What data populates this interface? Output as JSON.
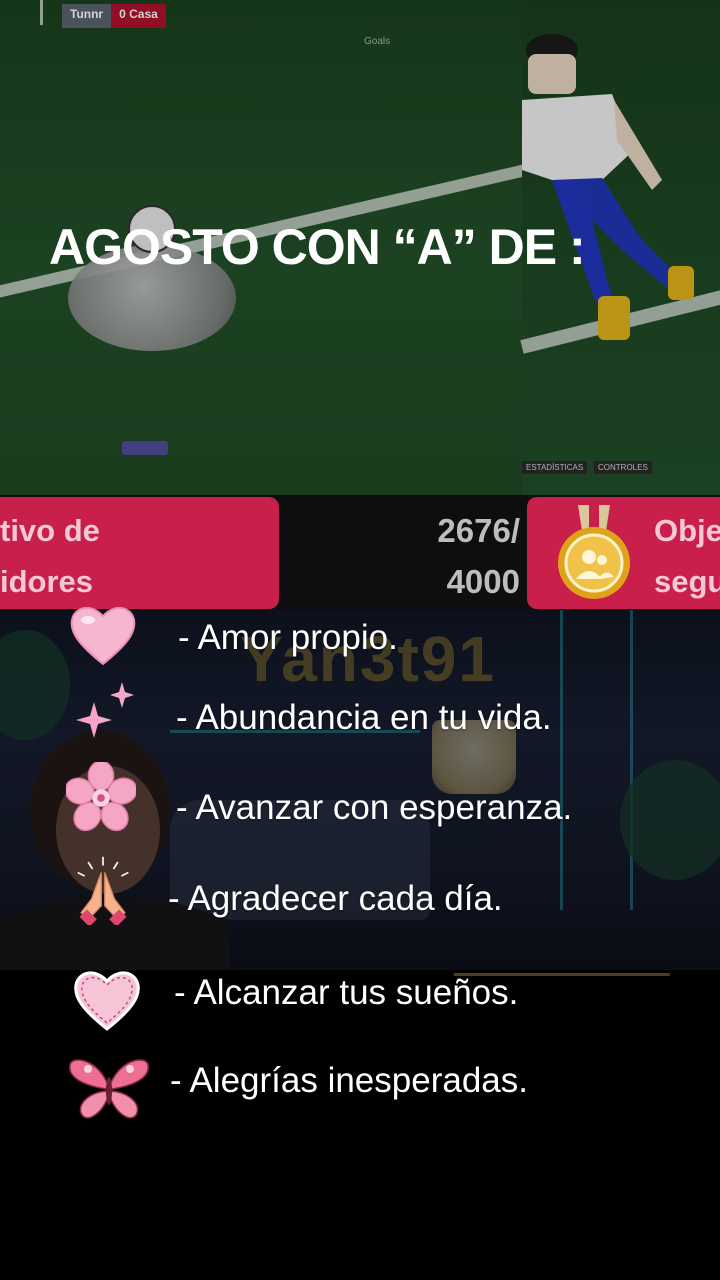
{
  "title": "AGOSTO CON “A” DE :",
  "game": {
    "score_home": "Tunnr",
    "score_value": "0",
    "score_away": "Casa",
    "mini_label": "Goals",
    "btn_stats": "ESTADÍSTICAS",
    "btn_controls": "CONTROLES"
  },
  "goal": {
    "left_text_line1": "tivo de",
    "left_text_line2": "idores",
    "counter_line1": "2676/",
    "counter_line2": "4000",
    "right_text_line1": "Obje",
    "right_text_line2": "segu",
    "colors": {
      "card": "#c8204b",
      "medal": "#e0a21b"
    }
  },
  "stream": {
    "channel_name": "Yan3t91"
  },
  "list": [
    {
      "icon": "pink-heart-icon",
      "text": "- Amor propio."
    },
    {
      "icon": "sparkles-icon",
      "text": "- Abundancia en tu vida."
    },
    {
      "icon": "cherry-blossom-icon",
      "text": "- Avanzar con esperanza."
    },
    {
      "icon": "praying-hands-icon",
      "text": "- Agradecer cada día."
    },
    {
      "icon": "stitched-heart-icon",
      "text": "- Alcanzar tus sueños."
    },
    {
      "icon": "butterfly-icon",
      "text": "- Alegrías inesperadas."
    }
  ]
}
